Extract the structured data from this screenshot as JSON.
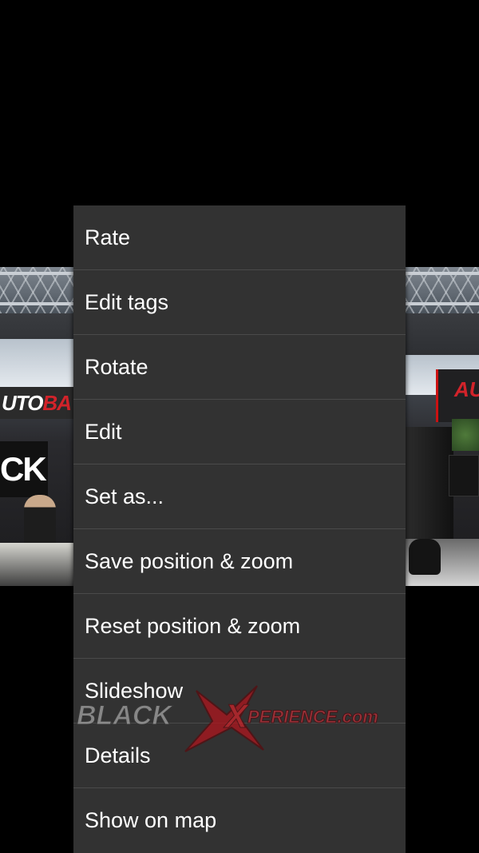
{
  "menu": {
    "items": [
      {
        "label": "Rate"
      },
      {
        "label": "Edit tags"
      },
      {
        "label": "Rotate"
      },
      {
        "label": "Edit"
      },
      {
        "label": "Set as..."
      },
      {
        "label": "Save position & zoom"
      },
      {
        "label": "Reset position & zoom"
      },
      {
        "label": "Slideshow"
      },
      {
        "label": "Details"
      },
      {
        "label": "Show on map"
      }
    ]
  },
  "photo": {
    "banner_left_prefix": "UTO",
    "banner_left_suffix": "BA",
    "sign_left": "CK",
    "banner_right": "AUTO"
  },
  "watermark": {
    "brand_black": "BLACK",
    "brand_x": "X",
    "brand_rest": "PERIENCE.com"
  },
  "colors": {
    "menu_background": "#323232",
    "menu_divider": "#4a4a4a",
    "menu_text": "#ffffff",
    "brand_red": "#d2232a"
  }
}
